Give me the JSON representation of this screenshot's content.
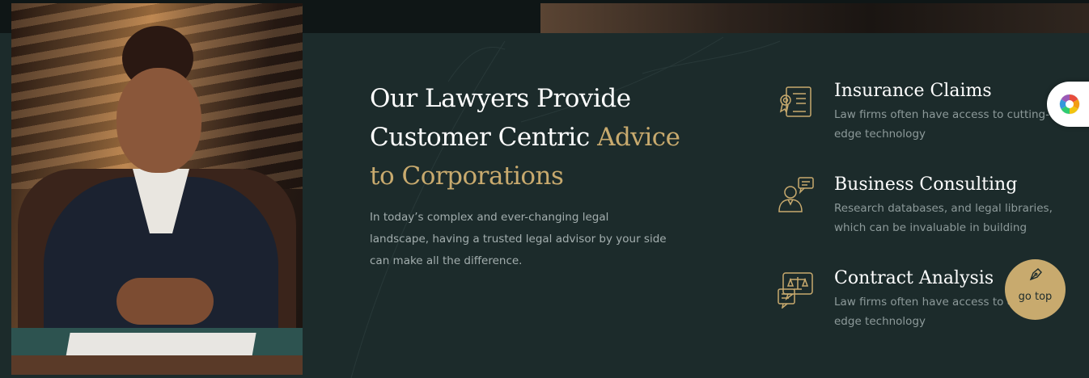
{
  "headline": {
    "line1": "Our Lawyers Provide",
    "line2_plain": "Customer Centric ",
    "line2_accent": "Advice",
    "line3_accent": "to Corporations"
  },
  "intro": "In today’s complex and ever-changing legal landscape, having a trusted legal advisor by your side can make all the difference.",
  "services": [
    {
      "icon": "certificate-icon",
      "title": "Insurance Claims",
      "description": "Law firms often have access to cutting-edge technology"
    },
    {
      "icon": "consultant-icon",
      "title": "Business Consulting",
      "description": "Research databases, and legal libraries, which can be invaluable in building"
    },
    {
      "icon": "scales-chat-icon",
      "title": "Contract Analysis",
      "description": "Law firms often have access to cutting-edge technology"
    }
  ],
  "go_top": {
    "label": "go top",
    "icon": "pen-nib-icon"
  },
  "palette_button": {
    "icon": "color-wheel-icon"
  },
  "colors": {
    "background": "#1c2b2b",
    "accent_gold": "#c8aa6e",
    "heading": "#ffffff",
    "body_text": "#a3aeae"
  }
}
